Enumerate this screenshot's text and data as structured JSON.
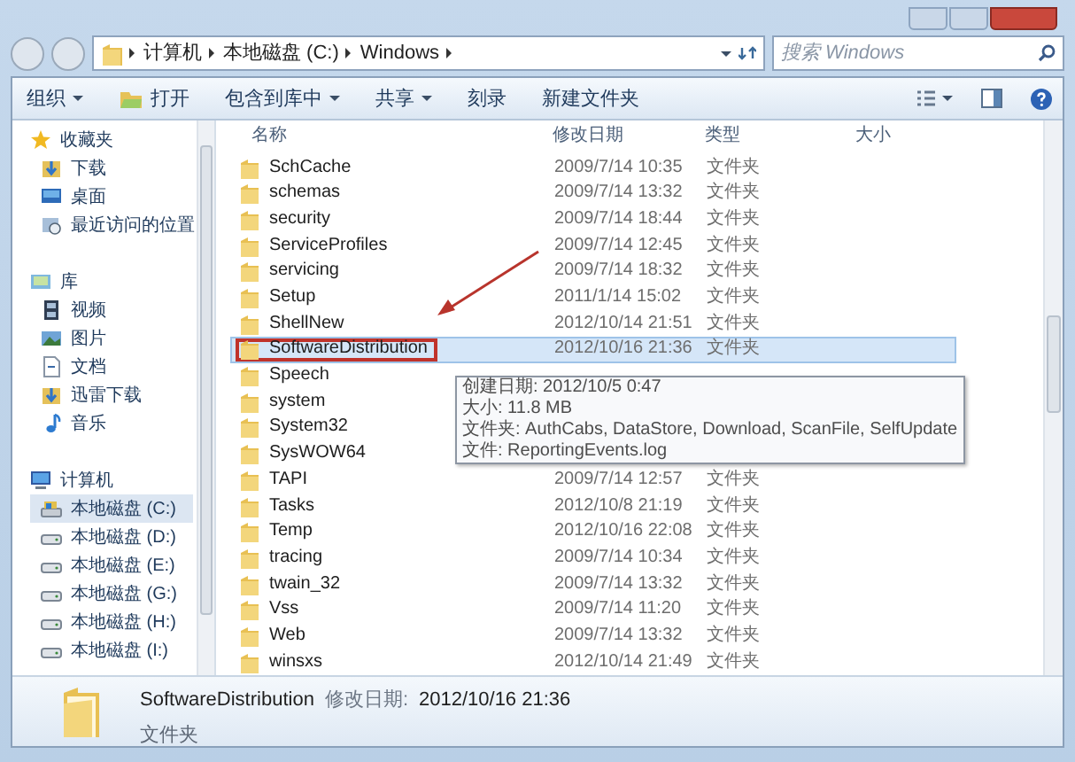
{
  "address_bar": {
    "segments": [
      "计算机",
      "本地磁盘 (C:)",
      "Windows"
    ],
    "search_placeholder": "搜索 Windows"
  },
  "toolbar": {
    "items": [
      {
        "label": "组织",
        "dropdown": true
      },
      {
        "label": "打开",
        "dropdown": false,
        "icon": true
      },
      {
        "label": "包含到库中",
        "dropdown": true
      },
      {
        "label": "共享",
        "dropdown": true
      },
      {
        "label": "刻录",
        "dropdown": false
      },
      {
        "label": "新建文件夹",
        "dropdown": false
      }
    ]
  },
  "sidebar": {
    "groups": [
      {
        "label": "收藏夹",
        "kind": "star",
        "children": [
          {
            "label": "下载",
            "kind": "download",
            "selected": false
          },
          {
            "label": "桌面",
            "kind": "desktop",
            "selected": false
          },
          {
            "label": "最近访问的位置",
            "kind": "recent",
            "selected": false
          }
        ]
      },
      {
        "label": "库",
        "kind": "library",
        "children": [
          {
            "label": "视频",
            "kind": "video",
            "selected": false
          },
          {
            "label": "图片",
            "kind": "picture",
            "selected": false
          },
          {
            "label": "文档",
            "kind": "document",
            "selected": false
          },
          {
            "label": "迅雷下载",
            "kind": "download",
            "selected": false
          },
          {
            "label": "音乐",
            "kind": "music",
            "selected": false
          }
        ]
      },
      {
        "label": "计算机",
        "kind": "computer",
        "children": [
          {
            "label": "本地磁盘 (C:)",
            "kind": "system-drive",
            "selected": true
          },
          {
            "label": "本地磁盘 (D:)",
            "kind": "drive",
            "selected": false
          },
          {
            "label": "本地磁盘 (E:)",
            "kind": "drive",
            "selected": false
          },
          {
            "label": "本地磁盘 (G:)",
            "kind": "drive",
            "selected": false
          },
          {
            "label": "本地磁盘 (H:)",
            "kind": "drive",
            "selected": false
          },
          {
            "label": "本地磁盘 (I:)",
            "kind": "drive",
            "selected": false
          }
        ]
      }
    ]
  },
  "file_list": {
    "columns": [
      "名称",
      "修改日期",
      "类型",
      "大小"
    ],
    "rows": [
      {
        "name": "SchCache",
        "modified": "2009/7/14 10:35",
        "type": "文件夹",
        "selected": false
      },
      {
        "name": "schemas",
        "modified": "2009/7/14 13:32",
        "type": "文件夹",
        "selected": false
      },
      {
        "name": "security",
        "modified": "2009/7/14 18:44",
        "type": "文件夹",
        "selected": false
      },
      {
        "name": "ServiceProfiles",
        "modified": "2009/7/14 12:45",
        "type": "文件夹",
        "selected": false
      },
      {
        "name": "servicing",
        "modified": "2009/7/14 18:32",
        "type": "文件夹",
        "selected": false
      },
      {
        "name": "Setup",
        "modified": "2011/1/14 15:02",
        "type": "文件夹",
        "selected": false
      },
      {
        "name": "ShellNew",
        "modified": "2012/10/14 21:51",
        "type": "文件夹",
        "selected": false
      },
      {
        "name": "SoftwareDistribution",
        "modified": "2012/10/16 21:36",
        "type": "文件夹",
        "selected": true,
        "highlighted": true
      },
      {
        "name": "Speech",
        "selected": false
      },
      {
        "name": "system",
        "selected": false
      },
      {
        "name": "System32",
        "selected": false
      },
      {
        "name": "SysWOW64",
        "selected": false
      },
      {
        "name": "TAPI",
        "modified": "2009/7/14 12:57",
        "type": "文件夹",
        "selected": false
      },
      {
        "name": "Tasks",
        "modified": "2012/10/8 21:19",
        "type": "文件夹",
        "selected": false
      },
      {
        "name": "Temp",
        "modified": "2012/10/16 22:08",
        "type": "文件夹",
        "selected": false
      },
      {
        "name": "tracing",
        "modified": "2009/7/14 10:34",
        "type": "文件夹",
        "selected": false
      },
      {
        "name": "twain_32",
        "modified": "2009/7/14 13:32",
        "type": "文件夹",
        "selected": false
      },
      {
        "name": "Vss",
        "modified": "2009/7/14 11:20",
        "type": "文件夹",
        "selected": false
      },
      {
        "name": "Web",
        "modified": "2009/7/14 13:32",
        "type": "文件夹",
        "selected": false
      },
      {
        "name": "winsxs",
        "modified": "2012/10/14 21:49",
        "type": "文件夹",
        "selected": false
      }
    ]
  },
  "tooltip": {
    "lines": [
      "创建日期: 2012/10/5 0:47",
      "大小: 11.8 MB",
      "文件夹: AuthCabs, DataStore, Download, ScanFile, SelfUpdate",
      "文件: ReportingEvents.log"
    ]
  },
  "details_pane": {
    "name": "SoftwareDistribution",
    "modified_label": "修改日期:",
    "modified": "2012/10/16 21:36",
    "type": "文件夹"
  }
}
